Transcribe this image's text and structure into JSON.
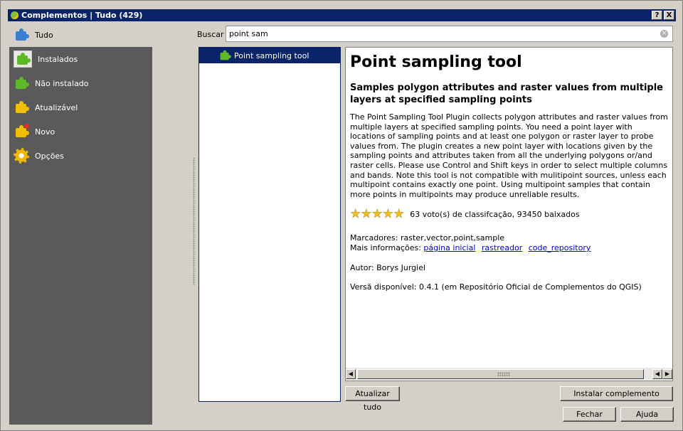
{
  "window": {
    "title": "Complementos | Tudo (429)",
    "help_btn": "?",
    "close_btn": "X"
  },
  "sidebar": {
    "top_item": "Tudo",
    "items": [
      {
        "label": "Instalados",
        "icon": "puzzle-installed-icon"
      },
      {
        "label": "Não instalado",
        "icon": "puzzle-not-installed-icon"
      },
      {
        "label": "Atualizável",
        "icon": "puzzle-upgradeable-icon"
      },
      {
        "label": "Novo",
        "icon": "puzzle-new-icon"
      },
      {
        "label": "Opções",
        "icon": "gear-icon"
      }
    ]
  },
  "search": {
    "label": "Buscar",
    "value": "point sam"
  },
  "plugin_list": {
    "items": [
      {
        "label": "Point sampling tool",
        "selected": true
      }
    ]
  },
  "detail": {
    "title": "Point sampling tool",
    "subtitle": "Samples polygon attributes and raster values from multiple layers at specified sampling points",
    "description": "The Point Sampling Tool Plugin collects polygon attributes and raster values from multiple layers at specified sampling points. You need a point layer with locations of sampling points and at least one polygon or raster layer to probe values from. The plugin creates a new point layer with locations given by the sampling points and attributes taken from all the underlying polygons or/and raster cells. Please use Control and Shift keys in order to select multiple columns and bands. Note this tool is not compatible with mulitipoint sources, unless each multipoint contains exactly one point. Using multipoint samples that contain more points in multipoints may produce unreliable results.",
    "stars": 5,
    "rating_text": "63 voto(s) de classifcação, 93450 baixados",
    "tags_line": "Marcadores: raster,vector,point,sample",
    "more_info_label": "Mais informações:",
    "links": [
      "página inicial",
      "rastreador",
      "code_repository"
    ],
    "author": "Autor: Borys Jurgiel",
    "version": "Versã disponível: 0.4.1 (em Repositório Oficial de Complementos do QGIS)"
  },
  "buttons": {
    "update_all": "Atualizar tudo",
    "install": "Instalar complemento",
    "close": "Fechar",
    "help": "Ajuda"
  }
}
